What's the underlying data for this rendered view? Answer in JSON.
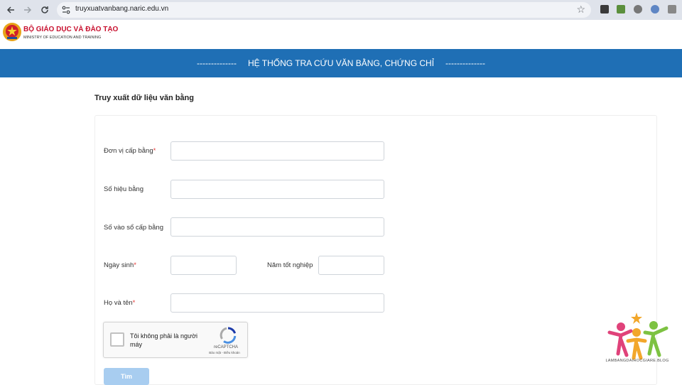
{
  "browser": {
    "url": "truyxuatvanbang.naric.edu.vn",
    "icons": [
      "back-icon",
      "forward-icon",
      "reload-icon",
      "site-info-icon",
      "bookmark-star-icon"
    ]
  },
  "ministry": {
    "title": "BỘ GIÁO DỤC VÀ ĐÀO TẠO",
    "subtitle": "MINISTRY OF EDUCATION AND TRAINING"
  },
  "banner": {
    "left_dashes": "--------------",
    "title": "HỆ THỐNG TRA CỨU VĂN BẰNG, CHỨNG CHỈ",
    "right_dashes": "--------------"
  },
  "page": {
    "title": "Truy xuất dữ liệu văn bằng"
  },
  "form": {
    "issuer": {
      "label": "Đơn vị cấp bằng",
      "required_mark": "*",
      "value": ""
    },
    "serial": {
      "label": "Số hiệu bằng",
      "value": ""
    },
    "register": {
      "label": "Số vào sổ cấp bằng",
      "value": ""
    },
    "dob": {
      "label": "Ngày sinh",
      "required_mark": "*",
      "value": ""
    },
    "grad_year": {
      "label": "Năm tốt nghiệp",
      "value": ""
    },
    "fullname": {
      "label": "Họ và tên",
      "required_mark": "*",
      "value": ""
    },
    "captcha": {
      "text": "Tôi không phải là người máy",
      "brand": "reCAPTCHA",
      "links": "Bảo mật - Điều khoản"
    },
    "search_label": "Tìm"
  },
  "watermark": {
    "text": "LAMBANGDAIHOCGIARE.BLOG"
  },
  "colors": {
    "banner": "#1f6fb5",
    "brand_red": "#c8102e",
    "button": "#a8cdf0"
  }
}
